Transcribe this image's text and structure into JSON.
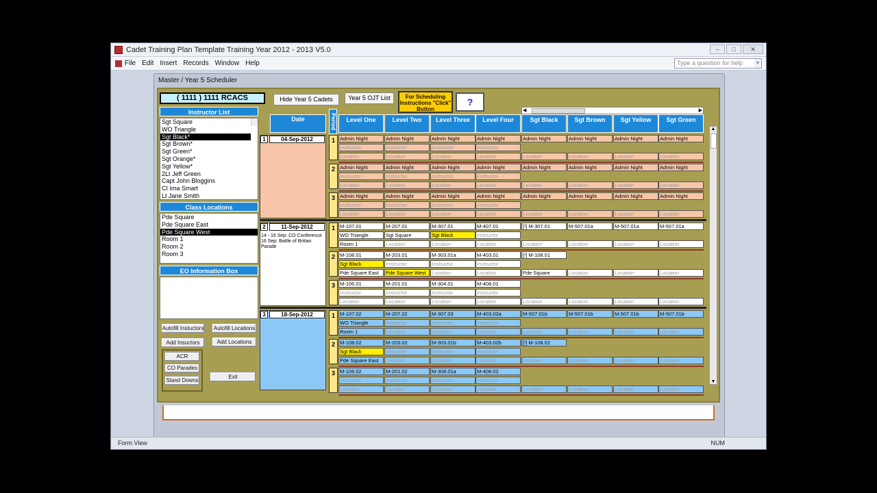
{
  "app": {
    "title": "Cadet Training Plan Template Training Year 2012 - 2013 V5.0",
    "menu": [
      "File",
      "Edit",
      "Insert",
      "Records",
      "Window",
      "Help"
    ],
    "question_placeholder": "Type a question for help",
    "status_left": "Form View",
    "status_right": "NUM"
  },
  "form": {
    "title": "Master / Year 5 Scheduler",
    "unit": "( 1111 ) 1111 RCACS",
    "instructor_header": "Instructor List",
    "instructors": [
      "Sgt Square",
      "WO Triangle",
      "Sgt Black*",
      "Sgt Brown*",
      "Sgt Green*",
      "Sgt Orange*",
      "Sgt Yellow*",
      "2Lt Jeff Green",
      "Capt John Bloggins",
      "CI Ima Smart",
      "Lt Jane Smith"
    ],
    "selected_instructor": 2,
    "locations_header": "Class Locations",
    "locations": [
      "Pde Square",
      "Pde Square East",
      "Pde Square West",
      "Room 1",
      "Room 2",
      "Room 3"
    ],
    "selected_location": 2,
    "eo_header": "EO Information Box",
    "buttons": {
      "autofill_instructors": "Autofill Instuctors",
      "autofill_locations": "Autofill Locations",
      "add_instructors": "Add Insuctors",
      "add_locations": "Add Locations",
      "acr": "ACR",
      "co_parades": "CO Parades",
      "stand_downs": "Stand Downs",
      "exit": "Exit",
      "hide_year5": "Hide Year 5 Cadets",
      "year5_ojt": "Year 5 OJT List",
      "sched_instr": "For Scheduling Instructions \"Click\" Button",
      "help": "?"
    },
    "date_header": "Date",
    "period_header": "Period",
    "columns": [
      "Level One",
      "Level Two",
      "Level Three",
      "Level Four",
      "Sgt Black",
      "Sgt Brown",
      "Sgt Yellow",
      "Sgt Green"
    ],
    "placeholder_instructor": "Instructor",
    "placeholder_location": "Location",
    "colors": {
      "week1": "#f7c6a8",
      "week2": "#ffffff",
      "week3": "#8cc8f5",
      "highlight": "#ffee00"
    },
    "weeks": [
      {
        "num": "1",
        "date": "04-Sep-2012",
        "notes": "",
        "theme": "week1",
        "periods": [
          {
            "n": "1",
            "rows": [
              [
                "Admin Night",
                "Admin Night",
                "Admin Night",
                "Admin Night",
                "Admin Night",
                "Admin Night",
                "Admin Night",
                "Admin Night"
              ],
              [
                "Instructor",
                "Instructor",
                "Instructor",
                "Instructor",
                "",
                "",
                "",
                ""
              ],
              [
                "Location",
                "Location",
                "Location",
                "Location",
                "Location",
                "Location",
                "Location",
                "Location"
              ]
            ]
          },
          {
            "n": "2",
            "rows": [
              [
                "Admin Night",
                "Admin Night",
                "Admin Night",
                "Admin Night",
                "Admin Night",
                "Admin Night",
                "Admin Night",
                "Admin Night"
              ],
              [
                "Instructor",
                "Instructor",
                "Instructor",
                "Instructor",
                "",
                "",
                "",
                ""
              ],
              [
                "Location",
                "Location",
                "Location",
                "Location",
                "Location",
                "Location",
                "Location",
                "Location"
              ]
            ]
          },
          {
            "n": "3",
            "rows": [
              [
                "Admin Night",
                "Admin Night",
                "Admin Night",
                "Admin Night",
                "Admin Night",
                "Admin Night",
                "Admin Night",
                "Admin Night"
              ],
              [
                "Instructor",
                "Instructor",
                "Instructor",
                "Instructor",
                "",
                "",
                "",
                ""
              ],
              [
                "Location",
                "Location",
                "Location",
                "Location",
                "Location",
                "Location",
                "Location",
                "Location"
              ]
            ]
          }
        ]
      },
      {
        "num": "2",
        "date": "11-Sep-2012",
        "notes": "14 - 16 Sep: CO Conference\n16 Sep: Battle of Britian Parade",
        "theme": "week2",
        "periods": [
          {
            "n": "1",
            "rows": [
              [
                "M-107.01",
                "M-207.01",
                "M-307.01",
                "M-407.01",
                "[!] M-307.01",
                "M-507.01a",
                "M-507.01a",
                "M-507.01a"
              ],
              [
                "WO Triangle",
                "Sgt Square",
                "Sgt Black",
                "Instructor",
                "",
                "",
                "",
                ""
              ],
              [
                "Room 1",
                "Location",
                "Location",
                "Location",
                "Location",
                "Location",
                "Location",
                "Location"
              ]
            ]
          },
          {
            "n": "2",
            "rows": [
              [
                "M-108.01",
                "M-203.01",
                "M-303.01a",
                "M-403.01",
                "[!] M-108.01",
                "",
                "",
                ""
              ],
              [
                "Sgt Black",
                "Instructor",
                "Instructor",
                "Instructor",
                "",
                "",
                "",
                ""
              ],
              [
                "Pde Square East",
                "Pde Square West",
                "Location",
                "Location",
                "Pde Square",
                "Location",
                "Location",
                "Location"
              ]
            ]
          },
          {
            "n": "3",
            "rows": [
              [
                "M-106.01",
                "M-201.01",
                "M-304.01",
                "M-408.01",
                "",
                "",
                "",
                ""
              ],
              [
                "Instructor",
                "Instructor",
                "Instructor",
                "Instructor",
                "",
                "",
                "",
                ""
              ],
              [
                "Location",
                "Location",
                "Location",
                "Location",
                "Location",
                "Location",
                "Location",
                "Location"
              ]
            ]
          }
        ]
      },
      {
        "num": "3",
        "date": "18-Sep-2012",
        "notes": "",
        "theme": "week3",
        "periods": [
          {
            "n": "1",
            "rows": [
              [
                "M-107.02",
                "M-207.02",
                "M-307.03",
                "M-403.02a",
                "M-507.01b",
                "M-507.01b",
                "M-507.01b",
                "M-507.01b"
              ],
              [
                "WO Triangle",
                "Instructor",
                "Instructor",
                "Instructor",
                "",
                "",
                "",
                ""
              ],
              [
                "Room 1",
                "Location",
                "Location",
                "Location",
                "Location",
                "Location",
                "Location",
                "Location"
              ]
            ]
          },
          {
            "n": "2",
            "rows": [
              [
                "M-108.02",
                "M-203.02",
                "M-303.01b",
                "M-403.02b",
                "[!] M-108.02",
                "",
                "",
                ""
              ],
              [
                "Sgt Black",
                "Instructor",
                "Instructor",
                "Instructor",
                "",
                "",
                "",
                ""
              ],
              [
                "Pde Square East",
                "Location",
                "Location",
                "Location",
                "Location",
                "Location",
                "Location",
                "Location"
              ]
            ]
          },
          {
            "n": "3",
            "rows": [
              [
                "M-106.02",
                "M-201.02",
                "M-308.01a",
                "M-408.02",
                "",
                "",
                "",
                ""
              ],
              [
                "Instructor",
                "Instructor",
                "Instructor",
                "Instructor",
                "",
                "",
                "",
                ""
              ],
              [
                "Location",
                "Location",
                "Location",
                "Location",
                "Location",
                "Location",
                "Location",
                "Location"
              ]
            ]
          }
        ]
      }
    ]
  }
}
